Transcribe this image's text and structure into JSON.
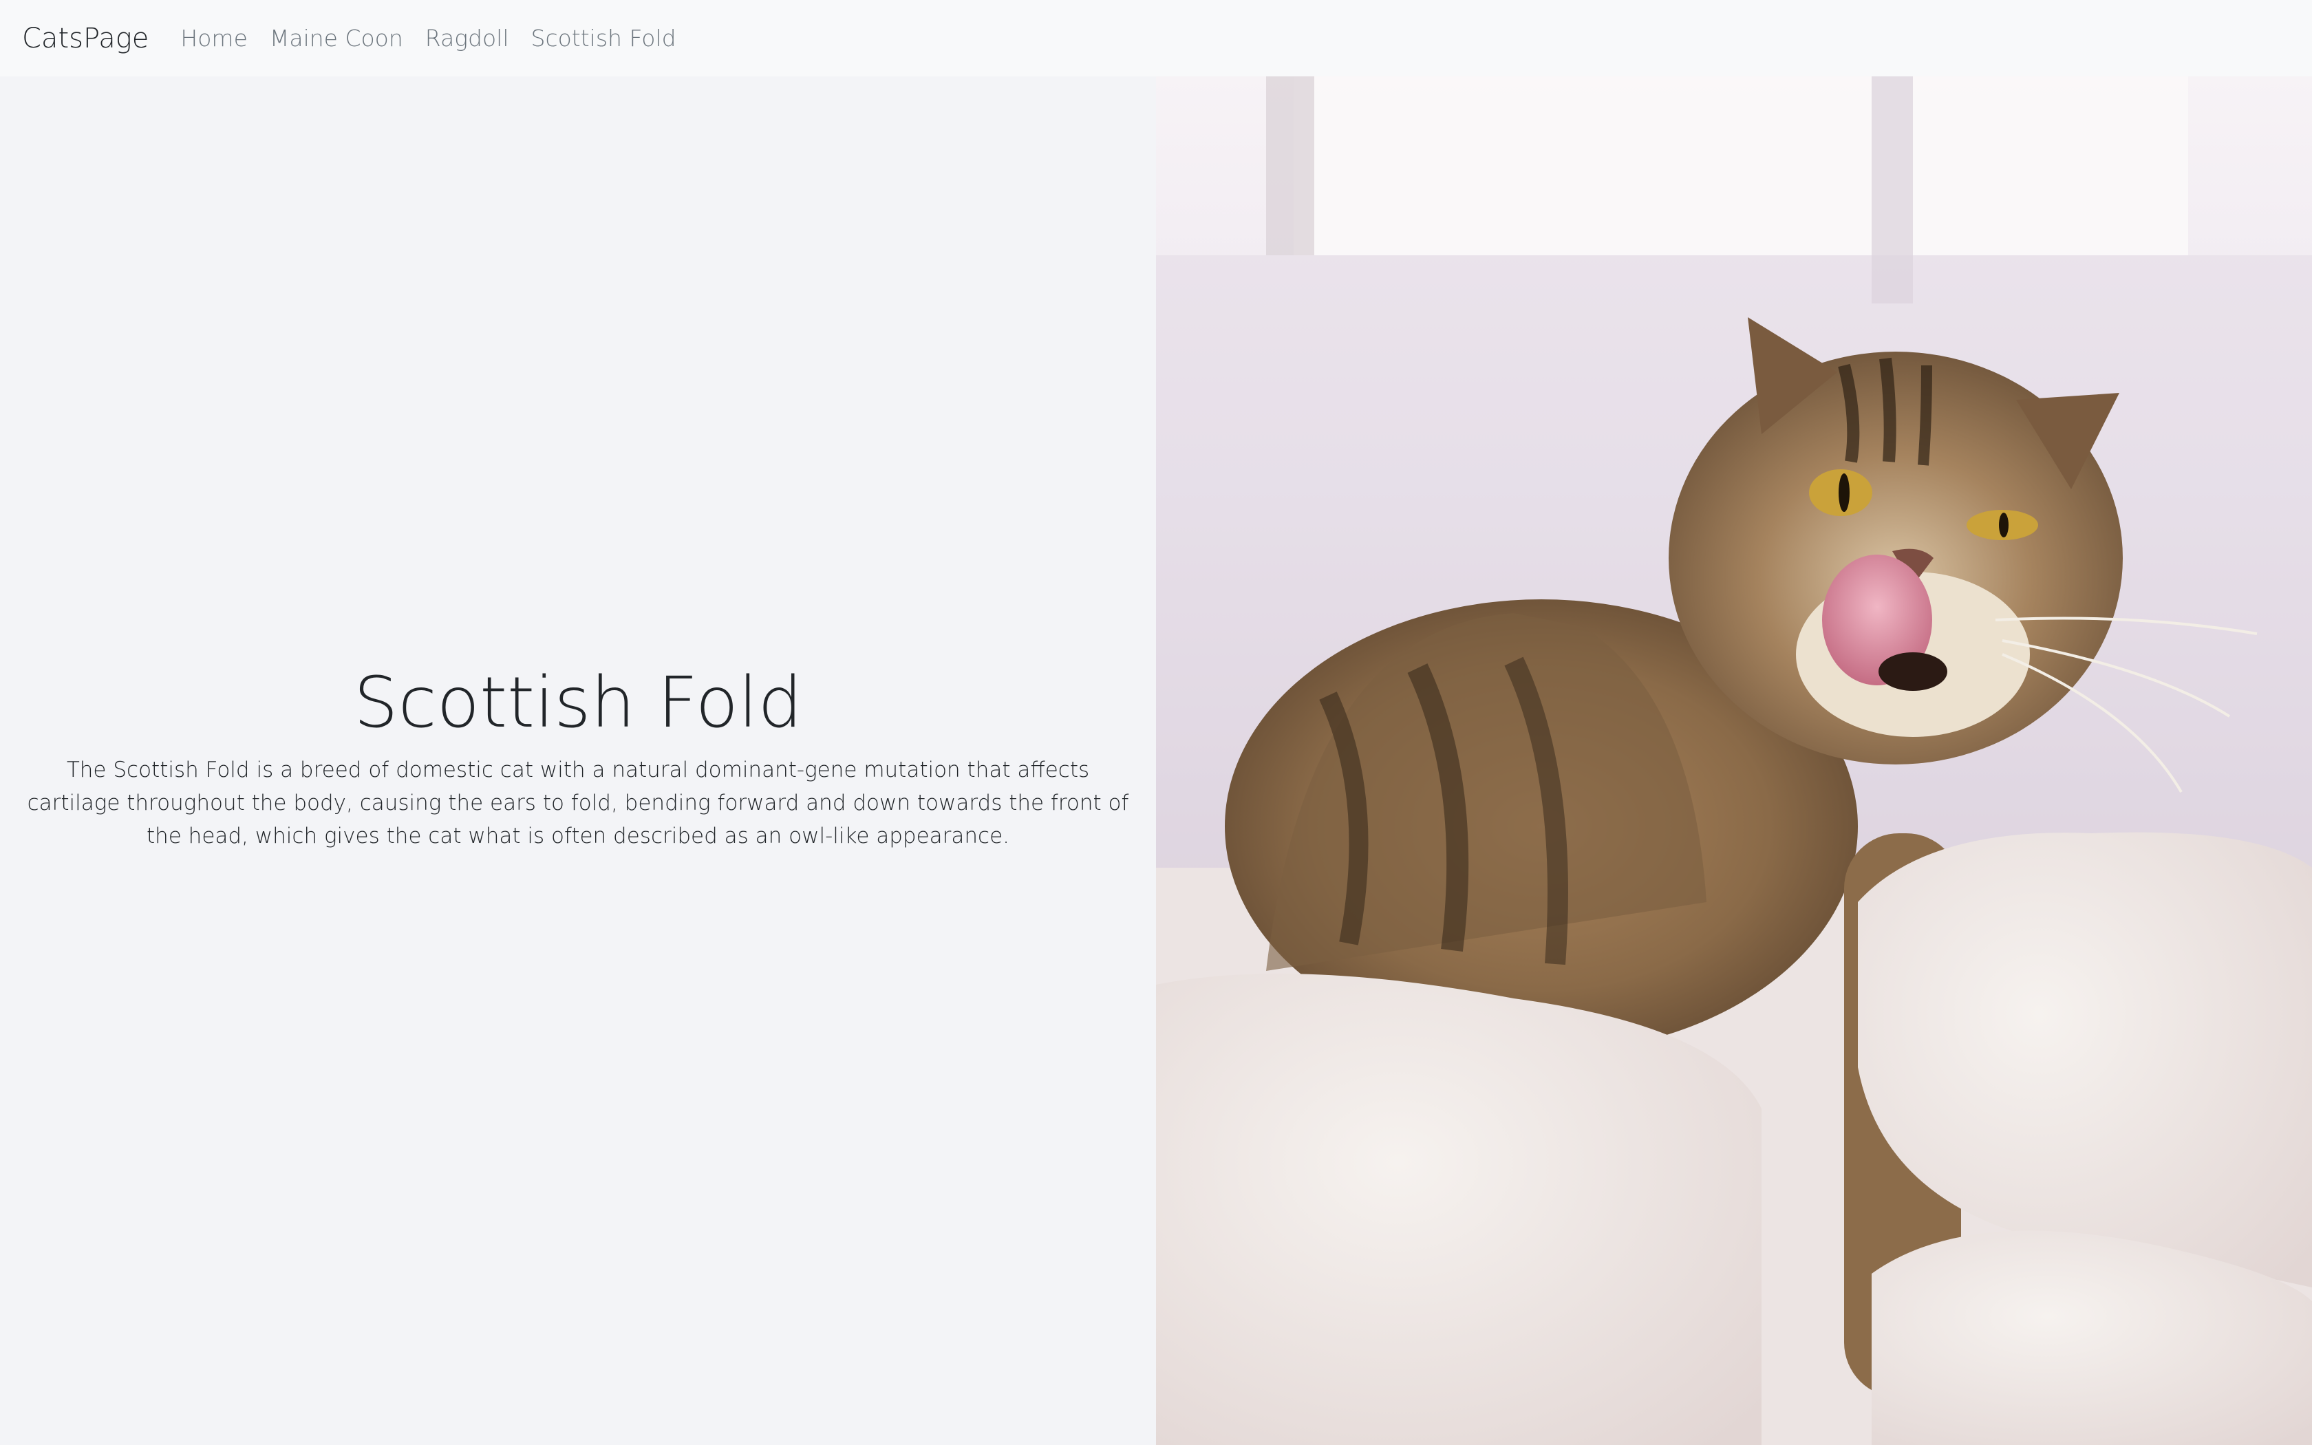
{
  "navbar": {
    "brand": "CatsPage",
    "items": [
      {
        "label": "Home"
      },
      {
        "label": "Maine Coon"
      },
      {
        "label": "Ragdoll"
      },
      {
        "label": "Scottish Fold"
      }
    ]
  },
  "main": {
    "title": "Scottish Fold",
    "description": "The Scottish Fold is a breed of domestic cat with a natural dominant-gene mutation that affects cartilage throughout the body, causing the ears to fold, bending forward and down towards the front of the head, which gives the cat what is often described as an owl-like appearance."
  },
  "colors": {
    "navbar_bg": "#f8f9fa",
    "page_bg": "#f3f4f7",
    "text": "#212529",
    "nav_link": "#6c757d"
  },
  "image": {
    "subject": "tabby-scottish-fold-cat-licking-lips-photo"
  }
}
